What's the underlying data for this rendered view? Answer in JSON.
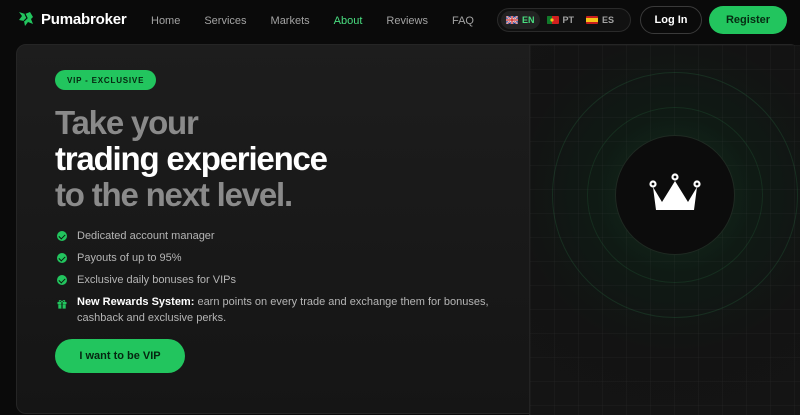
{
  "brand": {
    "name": "Pumabroker",
    "accent": "#22c55e"
  },
  "nav": {
    "items": [
      {
        "label": "Home"
      },
      {
        "label": "Services"
      },
      {
        "label": "Markets"
      },
      {
        "label": "About",
        "active": true
      },
      {
        "label": "Reviews"
      },
      {
        "label": "FAQ"
      }
    ]
  },
  "languages": [
    {
      "code": "EN",
      "flag": "uk-flag-icon",
      "active": true
    },
    {
      "code": "PT",
      "flag": "portugal-flag-icon"
    },
    {
      "code": "ES",
      "flag": "spain-flag-icon"
    }
  ],
  "auth": {
    "login_label": "Log In",
    "register_label": "Register"
  },
  "hero": {
    "badge": "VIP - EXCLUSIVE",
    "headline": {
      "line1": "Take your",
      "line2": "trading experience",
      "line3": "to the next level."
    },
    "features": [
      "Dedicated account manager",
      "Payouts of up to 95%",
      "Exclusive daily bonuses for VIPs"
    ],
    "reward": {
      "strong": "New Rewards System:",
      "text": " earn points on every trade and exchange them for bonuses, cashback and exclusive perks."
    },
    "cta_label": "I want to be VIP",
    "illustration_icon": "crown-icon"
  }
}
